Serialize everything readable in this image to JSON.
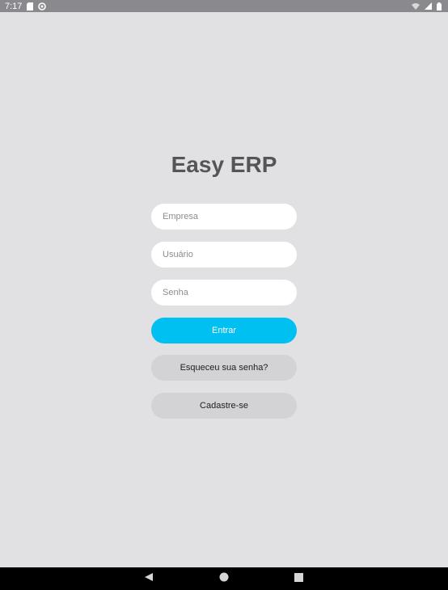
{
  "status_bar": {
    "time": "7:17",
    "icons_left": [
      "sd-card-icon",
      "sync-icon"
    ],
    "icons_right": [
      "wifi-icon",
      "signal-icon",
      "battery-icon"
    ]
  },
  "login": {
    "title": "Easy ERP",
    "company_placeholder": "Empresa",
    "user_placeholder": "Usuário",
    "password_placeholder": "Senha",
    "login_button": "Entrar",
    "forgot_password_button": "Esqueceu sua senha?",
    "register_button": "Cadastre-se"
  },
  "nav_bar": {
    "buttons": [
      "back-icon",
      "home-icon",
      "recents-icon"
    ]
  },
  "colors": {
    "background": "#e1e0e3",
    "primary": "#00bff1",
    "secondary_button": "#d3d2d5",
    "title": "#555459",
    "status_bar": "#8a898d"
  }
}
